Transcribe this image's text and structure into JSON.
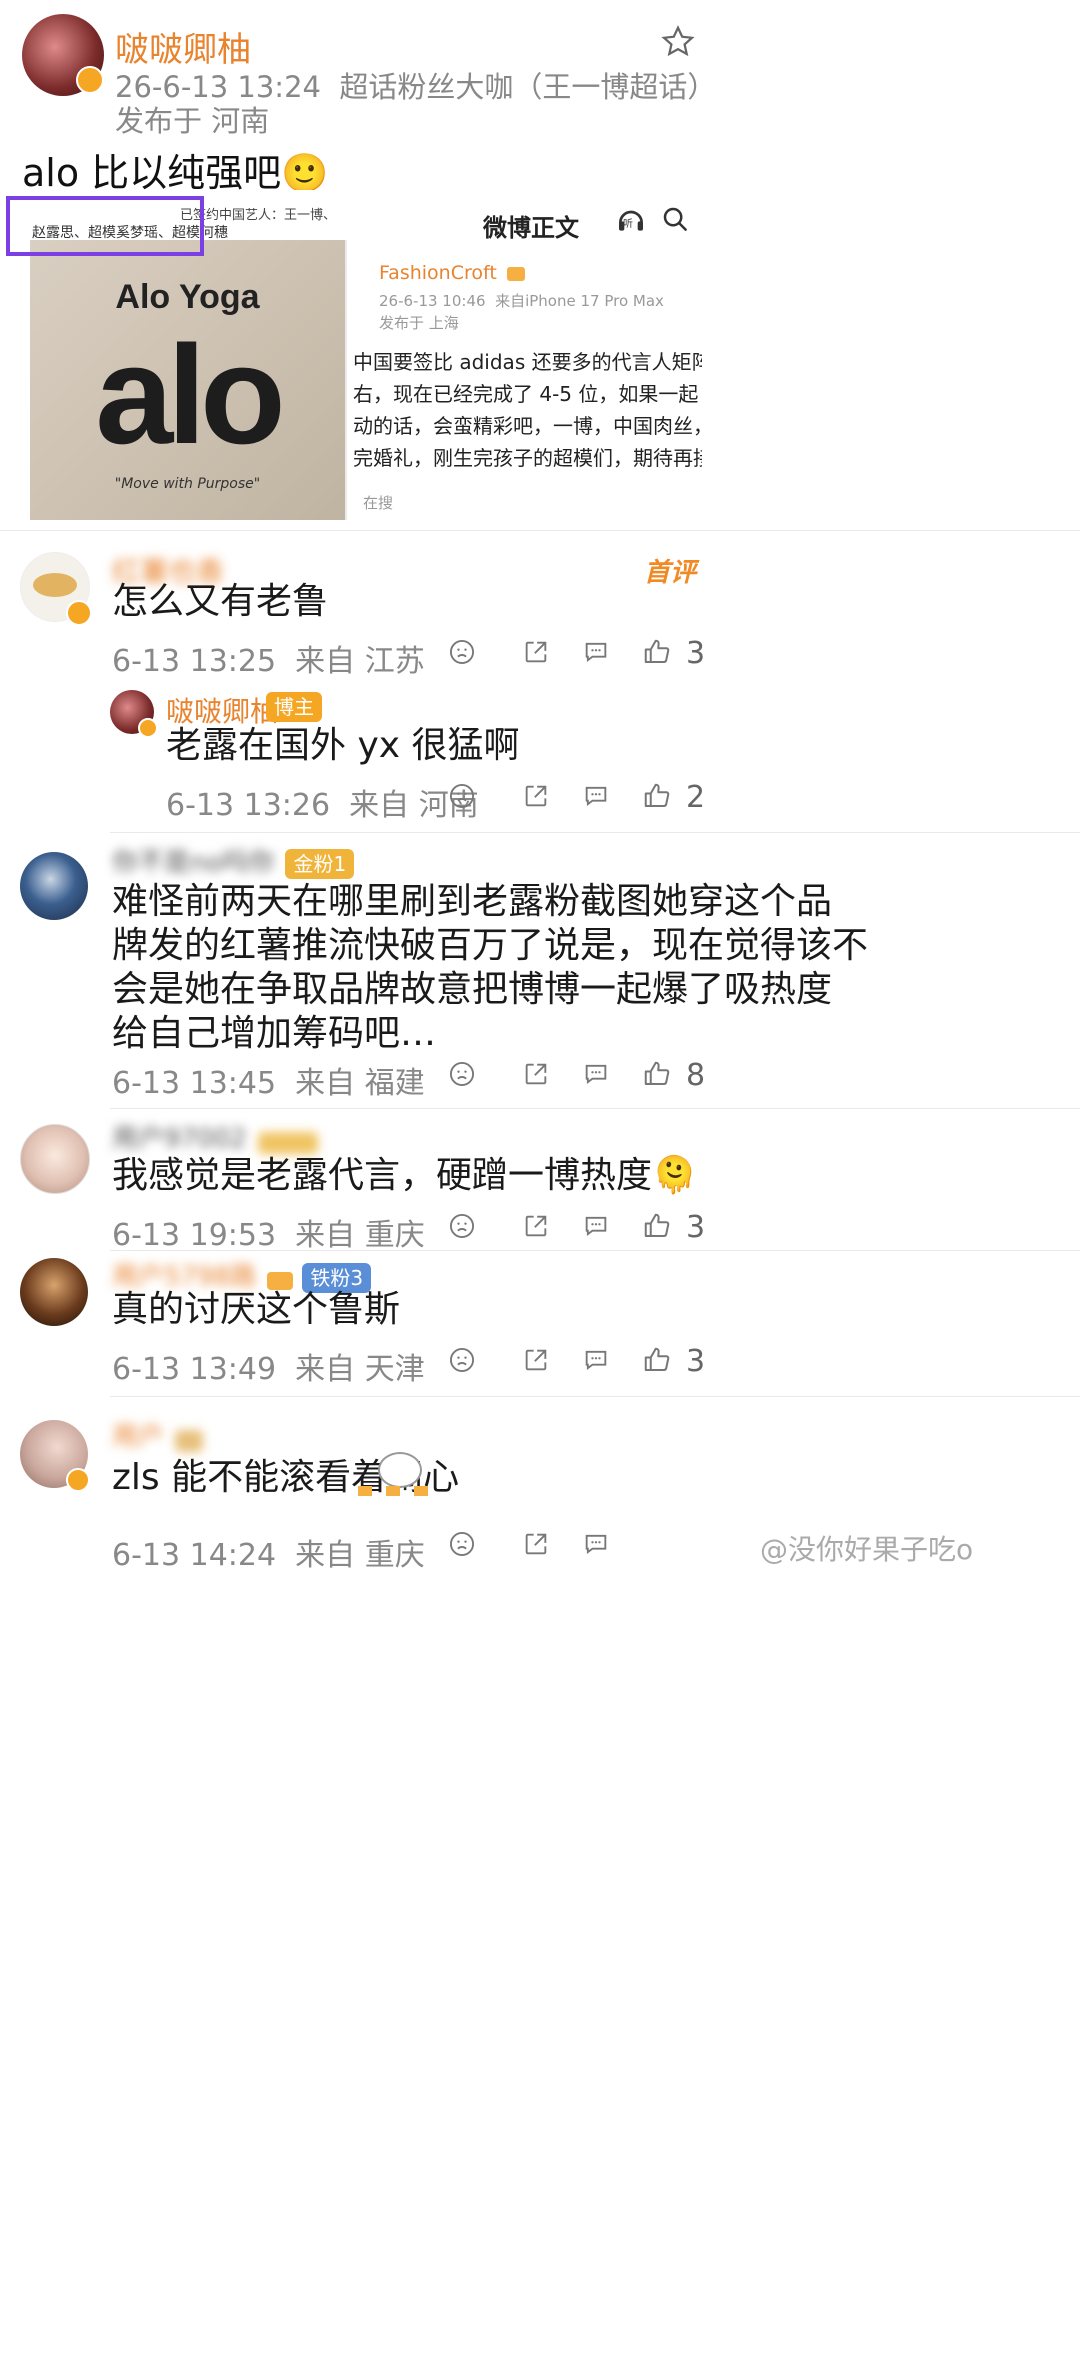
{
  "post": {
    "author_name": "啵啵卿柚",
    "author_blurred": "卿柚",
    "time_and_topic": "26-6-13 13:24  超话粉丝大咖（王一博超话）",
    "location": "发布于 河南",
    "text": "alo 比以纯强吧",
    "emoji": "🙂"
  },
  "embed": {
    "left_caption_line1": "已签约中国艺人：王一博、",
    "left_caption_line2": "赵露思、超模奚梦瑶、超模何穗",
    "brand_title": "Alo Yoga",
    "brand_logo": "alo",
    "brand_slogan": "\"Move with Purpose\"",
    "header_title": "微博正文",
    "listen_label": "听",
    "quoted_author": "FashionCroft",
    "quoted_meta": "26-6-13 10:46  来自iPhone 17 Pro Max",
    "quoted_location": "发布于 上海",
    "quoted_line1": "中国要签比 adidas 还要多的代言人矩阵。",
    "quoted_line2": "右，现在已经完成了 4-5 位，如果一起",
    "quoted_line3": "动的话，会蛮精彩吧，一博，中国肉丝，",
    "quoted_line4": "完婚礼，刚生完孩子的超模们，期待再接",
    "footer_hint": "在搜"
  },
  "comments": [
    {
      "name": "红薯也香",
      "first_badge": "首评",
      "text": "怎么又有老鲁",
      "time": "6-13 13:25",
      "from": "来自 江苏",
      "likes": "3"
    },
    {
      "name": "啵啵卿柚",
      "badge": "博主",
      "text": "老露在国外 yx 很猛啊",
      "time": "6-13 13:26",
      "from": "来自 河南",
      "likes": "2"
    },
    {
      "name": "你不是no吗你",
      "badge": "金粉1",
      "text_line1": "难怪前两天在哪里刷到老露粉截图她穿这个品",
      "text_line2": "牌发的红薯推流快破百万了说是，现在觉得该不",
      "text_line3": "会是她在争取品牌故意把博博一起爆了吸热度",
      "text_line4": "给自己增加筹码吧…",
      "time": "6-13 13:45",
      "from": "来自 福建",
      "likes": "8"
    },
    {
      "name": "用户97002",
      "text": "我感觉是老露代言，硬蹭一博热度",
      "emoji": "🫠",
      "time": "6-13 19:53",
      "from": "来自 重庆",
      "likes": "3"
    },
    {
      "name": "用户5798路",
      "badge": "铁粉3",
      "text": "真的讨厌这个鲁斯",
      "time": "6-13 13:49",
      "from": "来自 天津",
      "likes": "3"
    },
    {
      "name": "用户",
      "text": "zls 能不能滚看着闹心",
      "time": "6-13 14:24",
      "from": "来自 重庆",
      "likes": ""
    }
  ],
  "watermark": "@没你好果子吃o"
}
